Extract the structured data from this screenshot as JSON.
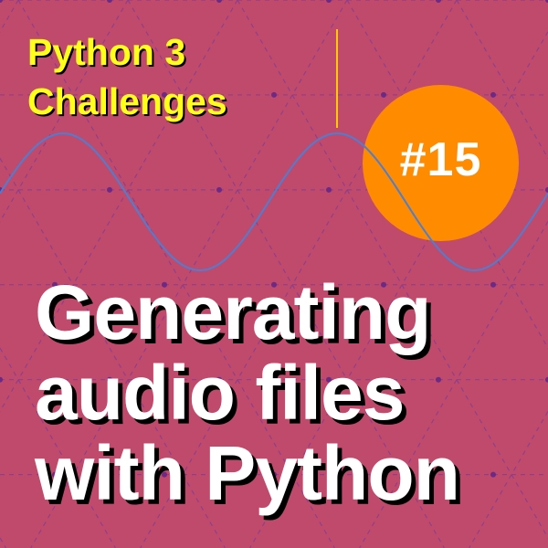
{
  "series": {
    "line1": "Python 3",
    "line2": "Challenges"
  },
  "badge": {
    "label": "#15"
  },
  "title": {
    "line1": "Generating",
    "line2": "audio files",
    "line3": "with Python"
  },
  "colors": {
    "background": "#c04a6c",
    "grid": "#8e3f8a",
    "grid_dot": "#6a2a86",
    "series_text": "#ffff1a",
    "badge": "#ff8c00",
    "wave": "#4a7fd4",
    "cursor_line": "#ffcc00",
    "title_text": "#ffffff"
  }
}
